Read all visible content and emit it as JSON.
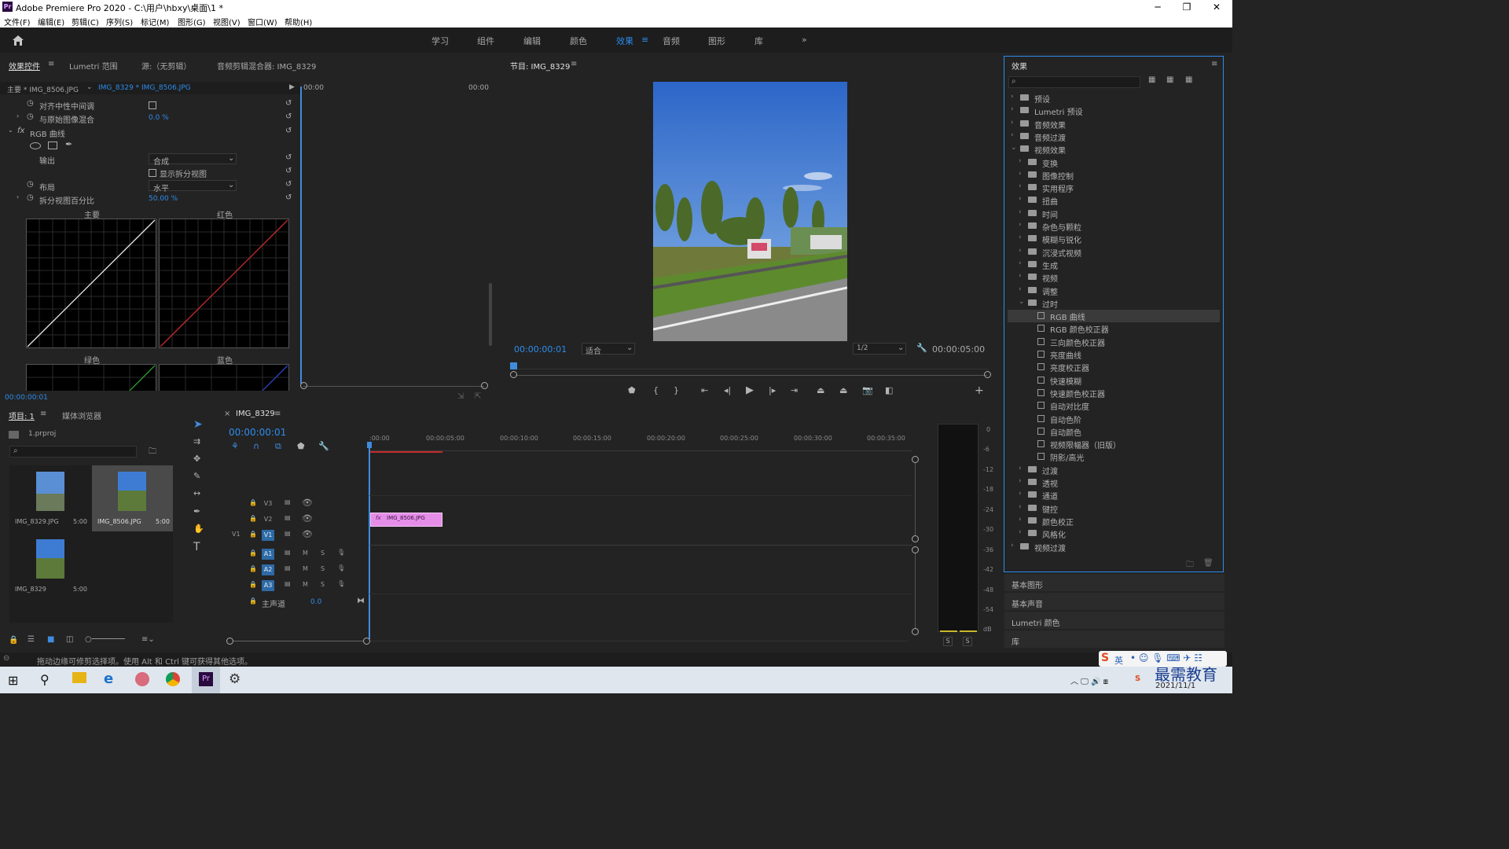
{
  "window": {
    "title": "Adobe Premiere Pro 2020 - C:\\用户\\hbxy\\桌面\\1 *",
    "app_badge": "Pr",
    "minimize": "─",
    "maximize": "❐",
    "close": "✕"
  },
  "menu": [
    "文件(F)",
    "编辑(E)",
    "剪辑(C)",
    "序列(S)",
    "标记(M)",
    "图形(G)",
    "视图(V)",
    "窗口(W)",
    "帮助(H)"
  ],
  "workspaces": {
    "items": [
      "学习",
      "组件",
      "编辑",
      "颜色",
      "效果",
      "音频",
      "图形",
      "库"
    ],
    "active": "效果",
    "more": "»"
  },
  "effect_controls": {
    "tabs": [
      "效果控件",
      "Lumetri 范围",
      "源:（无剪辑）",
      "音频剪辑混合器: IMG_8329"
    ],
    "clip_master": "主要 * IMG_8506.JPG",
    "clip_seq": "IMG_8329 * IMG_8506.JPG",
    "mini_time_start": "00:00",
    "mini_time_end": "00:00",
    "rows": {
      "align": "对齐中性中间调",
      "blend": "与原始图像混合",
      "blend_val": "0.0 %",
      "fx_name": "RGB 曲线",
      "output": "输出",
      "output_val": "合成",
      "show_split": "显示拆分视图",
      "layout": "布局",
      "layout_val": "水平",
      "split_pct": "拆分视图百分比",
      "split_pct_val": "50.00 %"
    },
    "curve_labels": [
      "主要",
      "红色",
      "绿色",
      "蓝色"
    ],
    "timecode": "00:00:00:01"
  },
  "program": {
    "title": "节目: IMG_8329",
    "timecode": "00:00:00:01",
    "fit": "适合",
    "quality": "1/2",
    "duration": "00:00:05:00"
  },
  "project": {
    "tabs": [
      "项目: 1",
      "媒体浏览器"
    ],
    "file": "1.prproj",
    "search_placeholder": "",
    "items": [
      {
        "name": "IMG_8329.JPG",
        "dur": "5:00"
      },
      {
        "name": "IMG_8506.JPG",
        "dur": "5:00"
      },
      {
        "name": "IMG_8329",
        "dur": "5:00"
      }
    ]
  },
  "timeline": {
    "title": "IMG_8329",
    "timecode": "00:00:00:01",
    "ruler": [
      ":00:00",
      "00:00:05:00",
      "00:00:10:00",
      "00:00:15:00",
      "00:00:20:00",
      "00:00:25:00",
      "00:00:30:00",
      "00:00:35:00"
    ],
    "video_tracks": [
      "V3",
      "V2",
      "V1"
    ],
    "src_v": "V1",
    "audio_tracks": [
      "A1",
      "A2",
      "A3"
    ],
    "master": "主声道",
    "master_val": "0.0",
    "clip": "IMG_8506.JPG",
    "clip_fx": "fx",
    "m": "M",
    "s": "S"
  },
  "meter": {
    "ticks": [
      "0",
      "-6",
      "-12",
      "-18",
      "-24",
      "-30",
      "-36",
      "-42",
      "-48",
      "-54",
      "dB"
    ],
    "s1": "S",
    "s2": "S"
  },
  "effects": {
    "title": "效果",
    "tree": [
      {
        "label": "预设",
        "level": 0,
        "type": "folder",
        "open": false
      },
      {
        "label": "Lumetri 预设",
        "level": 0,
        "type": "folder",
        "open": false
      },
      {
        "label": "音频效果",
        "level": 0,
        "type": "folder",
        "open": false
      },
      {
        "label": "音频过渡",
        "level": 0,
        "type": "folder",
        "open": false
      },
      {
        "label": "视频效果",
        "level": 0,
        "type": "folder",
        "open": true
      },
      {
        "label": "变换",
        "level": 1,
        "type": "folder",
        "open": false
      },
      {
        "label": "图像控制",
        "level": 1,
        "type": "folder",
        "open": false
      },
      {
        "label": "实用程序",
        "level": 1,
        "type": "folder",
        "open": false
      },
      {
        "label": "扭曲",
        "level": 1,
        "type": "folder",
        "open": false
      },
      {
        "label": "时间",
        "level": 1,
        "type": "folder",
        "open": false
      },
      {
        "label": "杂色与颗粒",
        "level": 1,
        "type": "folder",
        "open": false
      },
      {
        "label": "模糊与锐化",
        "level": 1,
        "type": "folder",
        "open": false
      },
      {
        "label": "沉浸式视频",
        "level": 1,
        "type": "folder",
        "open": false
      },
      {
        "label": "生成",
        "level": 1,
        "type": "folder",
        "open": false
      },
      {
        "label": "视频",
        "level": 1,
        "type": "folder",
        "open": false
      },
      {
        "label": "调整",
        "level": 1,
        "type": "folder",
        "open": false
      },
      {
        "label": "过时",
        "level": 1,
        "type": "folder",
        "open": true
      },
      {
        "label": "RGB 曲线",
        "level": 2,
        "type": "effect",
        "selected": true
      },
      {
        "label": "RGB 颜色校正器",
        "level": 2,
        "type": "effect"
      },
      {
        "label": "三向颜色校正器",
        "level": 2,
        "type": "effect"
      },
      {
        "label": "亮度曲线",
        "level": 2,
        "type": "effect"
      },
      {
        "label": "亮度校正器",
        "level": 2,
        "type": "effect"
      },
      {
        "label": "快速模糊",
        "level": 2,
        "type": "effect"
      },
      {
        "label": "快速颜色校正器",
        "level": 2,
        "type": "effect"
      },
      {
        "label": "自动对比度",
        "level": 2,
        "type": "effect"
      },
      {
        "label": "自动色阶",
        "level": 2,
        "type": "effect"
      },
      {
        "label": "自动颜色",
        "level": 2,
        "type": "effect"
      },
      {
        "label": "视频限幅器（旧版）",
        "level": 2,
        "type": "effect"
      },
      {
        "label": "阴影/高光",
        "level": 2,
        "type": "effect"
      },
      {
        "label": "过渡",
        "level": 1,
        "type": "folder",
        "open": false
      },
      {
        "label": "透视",
        "level": 1,
        "type": "folder",
        "open": false
      },
      {
        "label": "通道",
        "level": 1,
        "type": "folder",
        "open": false
      },
      {
        "label": "键控",
        "level": 1,
        "type": "folder",
        "open": false
      },
      {
        "label": "颜色校正",
        "level": 1,
        "type": "folder",
        "open": false
      },
      {
        "label": "风格化",
        "level": 1,
        "type": "folder",
        "open": false
      },
      {
        "label": "视频过渡",
        "level": 0,
        "type": "folder",
        "open": false
      }
    ],
    "side_panels": [
      "基本图形",
      "基本声音",
      "Lumetri 颜色",
      "库"
    ]
  },
  "status": {
    "hint": "拖动边缘可修剪选择项。使用 Alt 和 Ctrl 键可获得其他选项。"
  },
  "taskbar": {
    "date": "2021/11/1",
    "ime": "英",
    "watermark": "最需教育"
  },
  "colors": {
    "accent": "#2d8ceb",
    "clip": "#e58ee8",
    "playhead": "#3f8cde",
    "red_curve": "#c42a2a",
    "green_curve": "#2f9e2f"
  }
}
